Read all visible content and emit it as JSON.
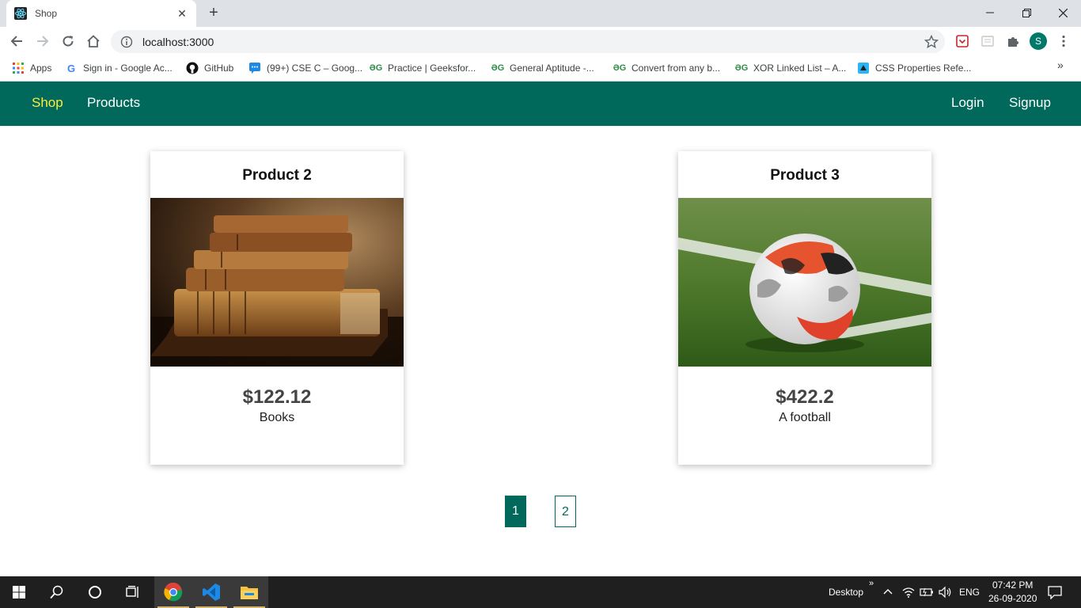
{
  "browser": {
    "tab_title": "Shop",
    "url": "localhost:3000",
    "profile_initial": "S",
    "bookmarks": [
      {
        "label": "Apps",
        "icon": "apps-grid-icon"
      },
      {
        "label": "Sign in - Google Ac...",
        "icon": "google-icon"
      },
      {
        "label": "GitHub",
        "icon": "github-icon"
      },
      {
        "label": "(99+) CSE C – Goog...",
        "icon": "google-chat-icon"
      },
      {
        "label": "Practice | Geeksfor...",
        "icon": "geeksforgeeks-icon"
      },
      {
        "label": "General Aptitude -...",
        "icon": "geeksforgeeks-icon"
      },
      {
        "label": "Convert from any b...",
        "icon": "geeksforgeeks-icon"
      },
      {
        "label": "XOR Linked List – A...",
        "icon": "geeksforgeeks-icon"
      },
      {
        "label": "CSS Properties Refe...",
        "icon": "css-ref-icon"
      }
    ]
  },
  "navbar": {
    "brand": "Shop",
    "products": "Products",
    "login": "Login",
    "signup": "Signup"
  },
  "products": [
    {
      "title": "Product 2",
      "price": "$122.12",
      "description": "Books",
      "image": "books"
    },
    {
      "title": "Product 3",
      "price": "$422.2",
      "description": "A football",
      "image": "football"
    }
  ],
  "pagination": {
    "pages": [
      "1",
      "2"
    ],
    "current": "1"
  },
  "taskbar": {
    "desktop_label": "Desktop",
    "language": "ENG",
    "time": "07:42 PM",
    "date": "26-09-2020"
  },
  "colors": {
    "primary": "#00695c",
    "active_link": "#ffeb3b"
  }
}
